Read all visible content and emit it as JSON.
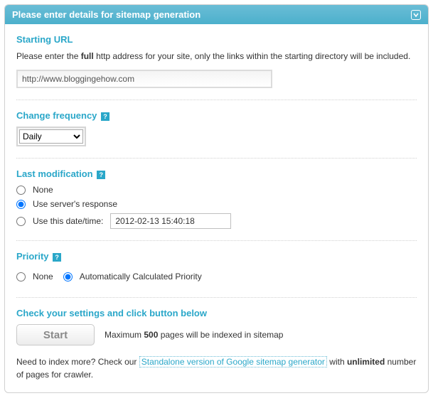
{
  "header": {
    "title": "Please enter details for sitemap generation"
  },
  "startingUrl": {
    "title": "Starting URL",
    "intro_pre": "Please enter the ",
    "intro_bold": "full",
    "intro_post": " http address for your site, only the links within the starting directory will be included.",
    "value": "http://www.bloggingehow.com"
  },
  "changeFrequency": {
    "title": "Change frequency",
    "selected": "Daily"
  },
  "lastModification": {
    "title": "Last modification",
    "options": {
      "none": "None",
      "server": "Use server's response",
      "date_label": "Use this date/time:"
    },
    "date_value": "2012-02-13 15:40:18"
  },
  "priority": {
    "title": "Priority",
    "options": {
      "none": "None",
      "auto": "Automatically Calculated Priority"
    }
  },
  "submit": {
    "title": "Check your settings and click button below",
    "button": "Start",
    "max_pre": "Maximum ",
    "max_bold": "500",
    "max_post": " pages will be indexed in sitemap"
  },
  "footer": {
    "pre": "Need to index more? Check our ",
    "link": "Standalone version of Google sitemap generator",
    "mid": " with ",
    "bold": "unlimited",
    "post": " number of pages for crawler."
  },
  "help_glyph": "?"
}
